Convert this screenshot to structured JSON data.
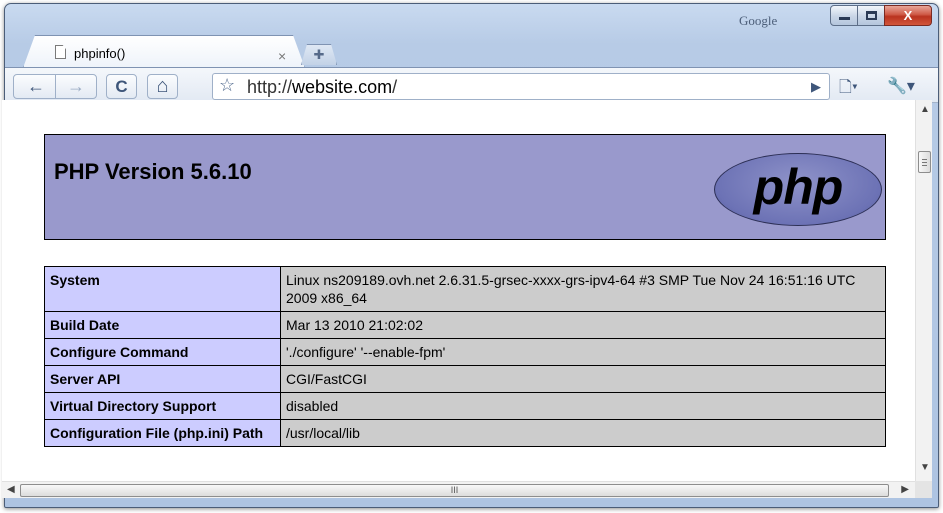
{
  "browser": {
    "google_label": "Google",
    "tab": {
      "title": "phpinfo()",
      "close": "×"
    },
    "new_tab": "✚",
    "toolbar": {
      "back": "←",
      "forward": "→",
      "reload": "C",
      "home": "⌂",
      "star": "☆",
      "url_prefix": "http://",
      "url_host": "website.com",
      "url_suffix": "/",
      "go": "▶",
      "page_menu": "🗋▾",
      "tools_menu": "🔧▾"
    },
    "window_controls": {
      "close": "X"
    }
  },
  "page": {
    "php_title": "PHP Version 5.6.10",
    "logo_text": "php",
    "rows": [
      {
        "key": "System",
        "value": "Linux ns209189.ovh.net 2.6.31.5-grsec-xxxx-grs-ipv4-64 #3 SMP Tue Nov 24 16:51:16 UTC 2009 x86_64"
      },
      {
        "key": "Build Date",
        "value": "Mar 13 2010 21:02:02"
      },
      {
        "key": "Configure Command",
        "value": "'./configure' '--enable-fpm'"
      },
      {
        "key": "Server API",
        "value": "CGI/FastCGI"
      },
      {
        "key": "Virtual Directory Support",
        "value": "disabled"
      },
      {
        "key": "Configuration File (php.ini) Path",
        "value": "/usr/local/lib"
      }
    ]
  },
  "scrollbars": {
    "h_grip": "III"
  }
}
